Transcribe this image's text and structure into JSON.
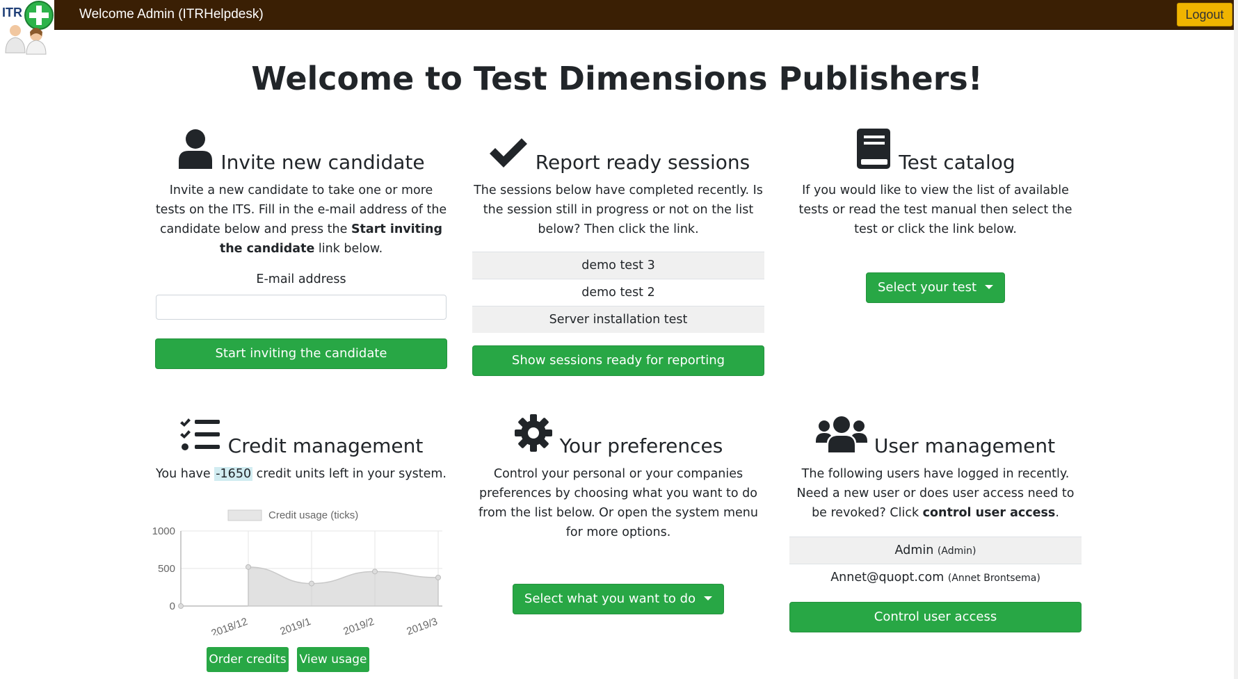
{
  "header": {
    "logo_text": "ITR",
    "welcome": "Welcome Admin (ITRHelpdesk)",
    "logout_label": "Logout"
  },
  "page_title": "Welcome to Test Dimensions Publishers!",
  "invite": {
    "title": "Invite new candidate",
    "text_a": "Invite a new candidate to take one or more tests on the ITS. Fill in the e-mail address of the candidate below and press the ",
    "text_bold": "Start inviting the candidate",
    "text_b": " link below.",
    "email_label": "E-mail address",
    "email_value": "",
    "button": "Start inviting the candidate"
  },
  "report": {
    "title": "Report ready sessions",
    "text": "The sessions below have completed recently. Is the session still in progress or not on the list below? Then click the link.",
    "sessions": [
      "demo test 3",
      "demo test 2",
      "Server installation test"
    ],
    "button": "Show sessions ready for reporting"
  },
  "catalog": {
    "title": "Test catalog",
    "text": "If you would like to view the list of available tests or read the test manual then select the test or click the link below.",
    "button": "Select your test"
  },
  "credit": {
    "title": "Credit management",
    "text_a": "You have ",
    "value": "-1650",
    "text_b": " credit units left in your system.",
    "order_button": "Order credits",
    "usage_button": "View usage"
  },
  "preferences": {
    "title": "Your preferences",
    "text": "Control your personal or your companies preferences by choosing what you want to do from the list below. Or open the system menu for more options.",
    "button": "Select what you want to do"
  },
  "users": {
    "title": "User management",
    "text_a": "The following users have logged in recently. Need a new user or does user access need to be revoked? Click ",
    "text_bold": "control user access",
    "text_b": ".",
    "list": [
      {
        "name": "Admin",
        "detail": "(Admin)"
      },
      {
        "name": "Annet@quopt.com",
        "detail": "(Annet Brontsema)"
      }
    ],
    "button": "Control user access"
  },
  "colors": {
    "header_bg": "#3a1f04",
    "logout_bg": "#f0b400",
    "button_green": "#28a745",
    "text": "#212529"
  },
  "chart_data": {
    "type": "area",
    "legend": "Credit usage (ticks)",
    "legend_position": "top",
    "x": [
      "",
      "2018/12",
      "2019/1",
      "2019/2",
      "2019/3"
    ],
    "series": [
      {
        "name": "Credit usage (ticks)",
        "values": [
          0,
          520,
          300,
          460,
          380
        ]
      }
    ],
    "yticks": [
      0,
      500,
      1000
    ],
    "ylim": [
      0,
      1000
    ],
    "grid": true
  }
}
